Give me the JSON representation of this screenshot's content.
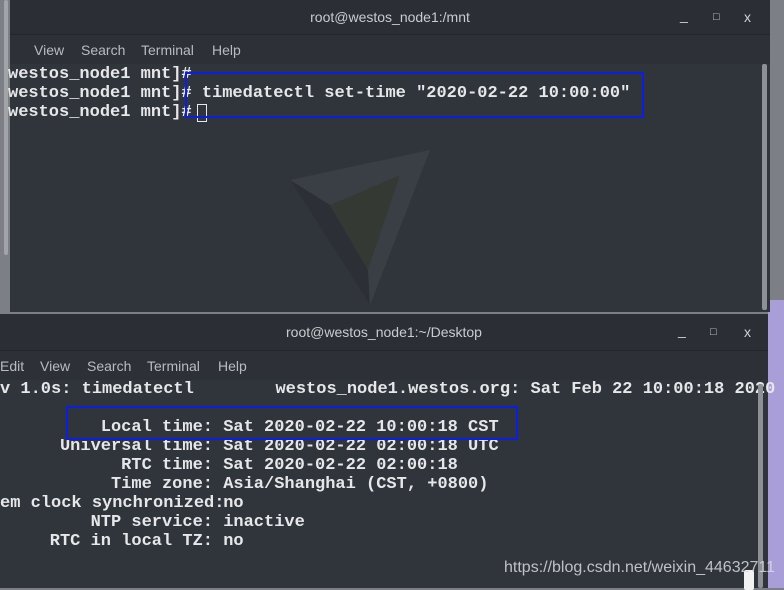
{
  "top_window": {
    "title": "root@westos_node1:/mnt",
    "menu": [
      "t",
      "View",
      "Search",
      "Terminal",
      "Help"
    ],
    "lines": [
      "westos_node1 mnt]#",
      "westos_node1 mnt]# timedatectl set-time \"2020-02-22 10:00:00\"",
      "westos_node1 mnt]# "
    ]
  },
  "bottom_window": {
    "title": "root@westos_node1:~/Desktop",
    "menu": [
      "Edit",
      "View",
      "Search",
      "Terminal",
      "Help"
    ],
    "header": "v 1.0s: timedatectl        westos_node1.westos.org: Sat Feb 22 10:00:18 2020",
    "rows": [
      {
        "label": "Local time:",
        "value": "Sat 2020-02-22 10:00:18 CST"
      },
      {
        "label": "Universal time:",
        "value": "Sat 2020-02-22 02:00:18 UTC"
      },
      {
        "label": "RTC time:",
        "value": "Sat 2020-02-22 02:00:18"
      },
      {
        "label": "Time zone:",
        "value": "Asia/Shanghai (CST, +0800)"
      },
      {
        "label": "em clock synchronized:",
        "value": "no"
      },
      {
        "label": "NTP service:",
        "value": "inactive"
      },
      {
        "label": "RTC in local TZ:",
        "value": "no"
      }
    ]
  },
  "controls": {
    "minimize": "_",
    "maximize": "□",
    "close": "x"
  },
  "watermark": "https://blog.csdn.net/weixin_44632711",
  "colors": {
    "highlight": "#0a1ee8",
    "terminal_bg": "#30353c",
    "desktop": "#a99ed8"
  }
}
